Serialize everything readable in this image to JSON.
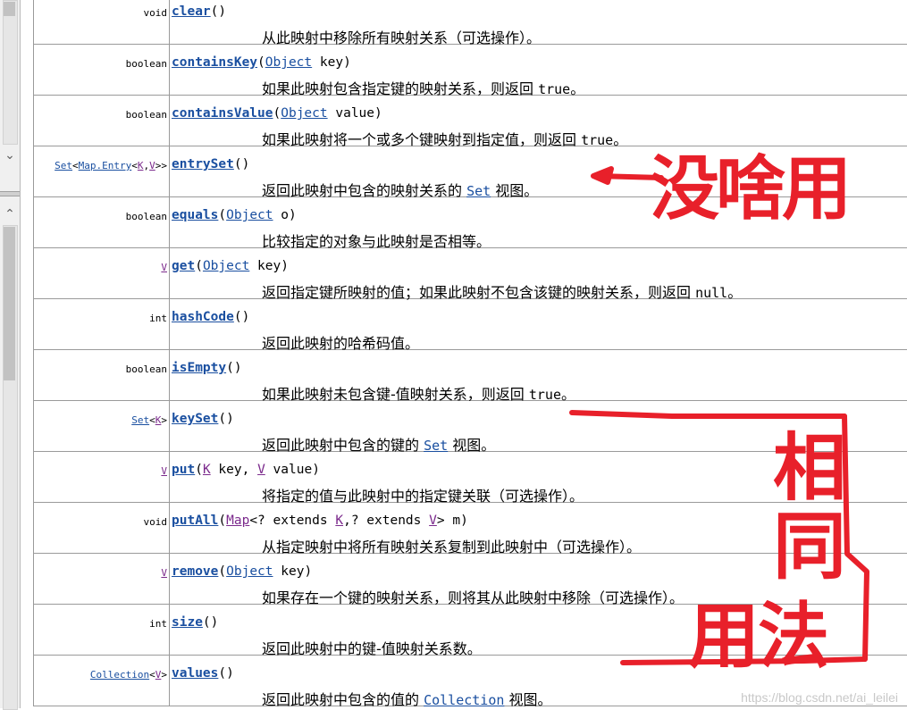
{
  "methods": [
    {
      "type": "void",
      "type_link": false,
      "name": "clear",
      "params": [],
      "desc_pre": "从此映射中移除所有映射关系（可选操作）。",
      "desc_code": "",
      "desc_post": ""
    },
    {
      "type": "boolean",
      "type_link": false,
      "name": "containsKey",
      "params": [
        {
          "t": "Object",
          "l": "lnk"
        },
        {
          "t": " key",
          "l": ""
        }
      ],
      "desc_pre": "如果此映射包含指定键的映射关系，则返回 ",
      "desc_code": "true",
      "desc_post": "。"
    },
    {
      "type": "boolean",
      "type_link": false,
      "name": "containsValue",
      "params": [
        {
          "t": "Object",
          "l": "lnk"
        },
        {
          "t": " value",
          "l": ""
        }
      ],
      "desc_pre": "如果此映射将一个或多个键映射到指定值，则返回 ",
      "desc_code": "true",
      "desc_post": "。"
    },
    {
      "type": "Set<Map.Entry<K,V>>",
      "type_link": true,
      "name": "entrySet",
      "params": [],
      "desc_pre": "返回此映射中包含的映射关系的 ",
      "desc_code": "Set",
      "desc_code_link": true,
      "desc_post": " 视图。"
    },
    {
      "type": "boolean",
      "type_link": false,
      "name": "equals",
      "params": [
        {
          "t": "Object",
          "l": "lnk"
        },
        {
          "t": " o",
          "l": ""
        }
      ],
      "desc_pre": "比较指定的对象与此映射是否相等。",
      "desc_code": "",
      "desc_post": ""
    },
    {
      "type": "V",
      "type_link": true,
      "type_gen": true,
      "name": "get",
      "params": [
        {
          "t": "Object",
          "l": "lnk"
        },
        {
          "t": " key",
          "l": ""
        }
      ],
      "desc_pre": "返回指定键所映射的值；如果此映射不包含该键的映射关系，则返回 ",
      "desc_code": "null",
      "desc_post": "。"
    },
    {
      "type": "int",
      "type_link": false,
      "name": "hashCode",
      "params": [],
      "desc_pre": "返回此映射的哈希码值。",
      "desc_code": "",
      "desc_post": ""
    },
    {
      "type": "boolean",
      "type_link": false,
      "name": "isEmpty",
      "params": [],
      "desc_pre": "如果此映射未包含键-值映射关系，则返回 ",
      "desc_code": "true",
      "desc_post": "。"
    },
    {
      "type": "Set<K>",
      "type_link": true,
      "name": "keySet",
      "params": [],
      "desc_pre": "返回此映射中包含的键的 ",
      "desc_code": "Set",
      "desc_code_link": true,
      "desc_post": " 视图。"
    },
    {
      "type": "V",
      "type_link": true,
      "type_gen": true,
      "name": "put",
      "params": [
        {
          "t": "K",
          "l": "gen"
        },
        {
          "t": " key, ",
          "l": ""
        },
        {
          "t": "V",
          "l": "gen"
        },
        {
          "t": " value",
          "l": ""
        }
      ],
      "desc_pre": "将指定的值与此映射中的指定键关联（可选操作）。",
      "desc_code": "",
      "desc_post": ""
    },
    {
      "type": "void",
      "type_link": false,
      "name": "putAll",
      "params": [
        {
          "t": "Map",
          "l": "gen"
        },
        {
          "t": "<? extends ",
          "l": ""
        },
        {
          "t": "K",
          "l": "gen"
        },
        {
          "t": ",? extends ",
          "l": ""
        },
        {
          "t": "V",
          "l": "gen"
        },
        {
          "t": "> m",
          "l": ""
        }
      ],
      "desc_pre": "从指定映射中将所有映射关系复制到此映射中（可选操作）。",
      "desc_code": "",
      "desc_post": ""
    },
    {
      "type": "V",
      "type_link": true,
      "type_gen": true,
      "name": "remove",
      "params": [
        {
          "t": "Object",
          "l": "lnk"
        },
        {
          "t": " key",
          "l": ""
        }
      ],
      "desc_pre": "如果存在一个键的映射关系，则将其从此映射中移除（可选操作）。",
      "desc_code": "",
      "desc_post": ""
    },
    {
      "type": "int",
      "type_link": false,
      "name": "size",
      "params": [],
      "desc_pre": "返回此映射中的键-值映射关系数。",
      "desc_code": "",
      "desc_post": ""
    },
    {
      "type": "Collection<V>",
      "type_link": true,
      "name": "values",
      "params": [],
      "desc_pre": "返回此映射中包含的值的 ",
      "desc_code": "Collection",
      "desc_code_link": true,
      "desc_post": " 视图。"
    }
  ],
  "annotations": {
    "note1": "没啥用",
    "note2": "相同用法",
    "color": "#e8202a"
  },
  "watermark": "https://blog.csdn.net/ai_leilei"
}
